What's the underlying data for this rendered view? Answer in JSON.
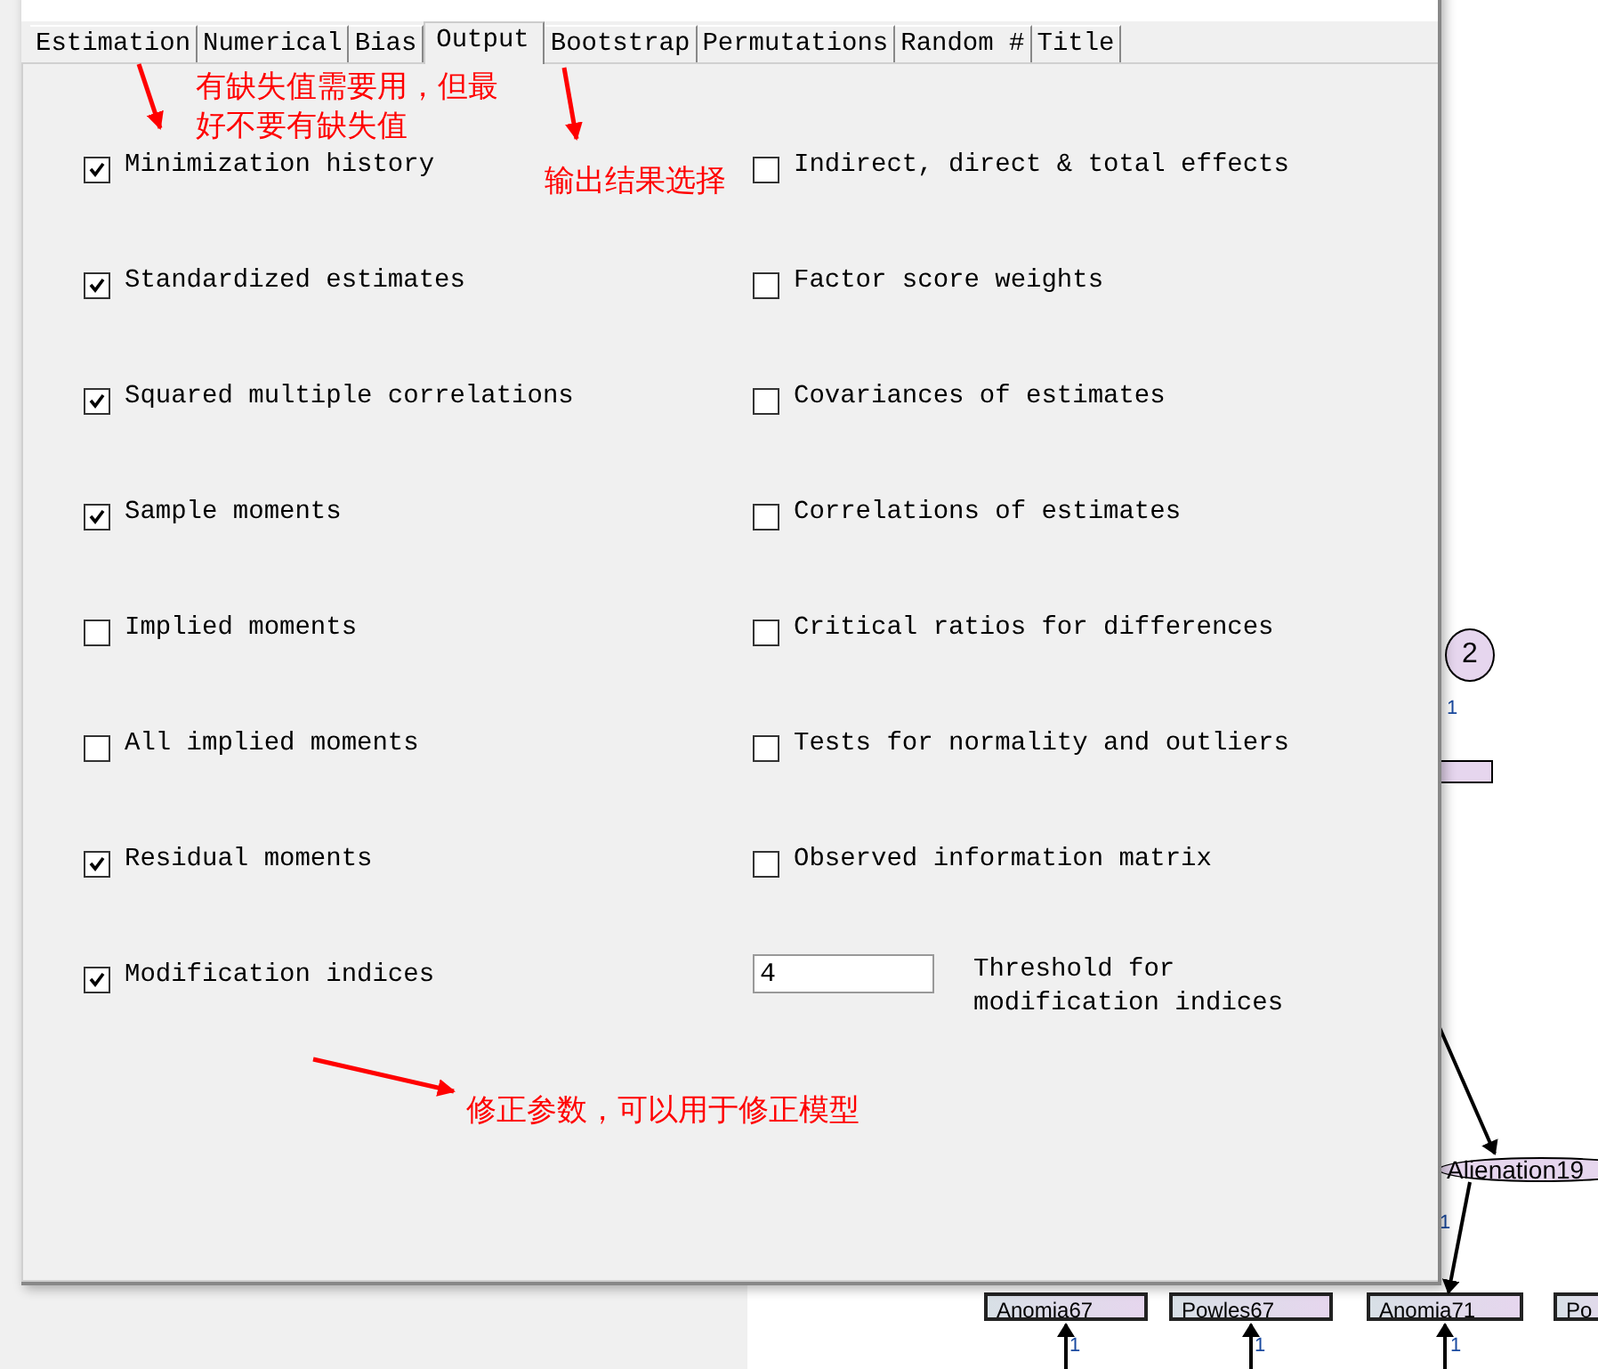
{
  "tabs": [
    {
      "label": "Estimation",
      "selected": false
    },
    {
      "label": "Numerical",
      "selected": false
    },
    {
      "label": "Bias",
      "selected": false
    },
    {
      "label": "Output",
      "selected": true
    },
    {
      "label": "Bootstrap",
      "selected": false
    },
    {
      "label": "Permutations",
      "selected": false
    },
    {
      "label": "Random #",
      "selected": false
    },
    {
      "label": "Title",
      "selected": false
    }
  ],
  "left_options": [
    {
      "label": "Minimization history",
      "checked": true
    },
    {
      "label": "Standardized estimates",
      "checked": true
    },
    {
      "label": "Squared multiple correlations",
      "checked": true
    },
    {
      "label": "Sample moments",
      "checked": true
    },
    {
      "label": "Implied moments",
      "checked": false
    },
    {
      "label": "All implied moments",
      "checked": false
    },
    {
      "label": "Residual moments",
      "checked": true
    },
    {
      "label": "Modification indices",
      "checked": true
    }
  ],
  "right_options": [
    {
      "label": "Indirect, direct & total effects",
      "checked": false
    },
    {
      "label": "Factor score weights",
      "checked": false
    },
    {
      "label": "Covariances of estimates",
      "checked": false
    },
    {
      "label": "Correlations of estimates",
      "checked": false
    },
    {
      "label": "Critical ratios for differences",
      "checked": false
    },
    {
      "label": "Tests for normality and outliers",
      "checked": false
    },
    {
      "label": "Observed information matrix",
      "checked": false
    }
  ],
  "threshold": {
    "value": "4",
    "label": "Threshold for modification indices"
  },
  "annotations": [
    "有缺失值需要用，但最好不要有缺失值",
    "输出结果选择",
    "修正参数，可以用于修正模型"
  ],
  "diagram": {
    "latent": [
      {
        "label": "2"
      },
      {
        "label": "Alienation19"
      }
    ],
    "observed": [
      {
        "label": "Anomia67"
      },
      {
        "label": "Powles67"
      },
      {
        "label": "Anomia71"
      },
      {
        "label": "Po"
      }
    ],
    "weights": [
      "1",
      "1",
      "1",
      "1",
      "1"
    ]
  }
}
